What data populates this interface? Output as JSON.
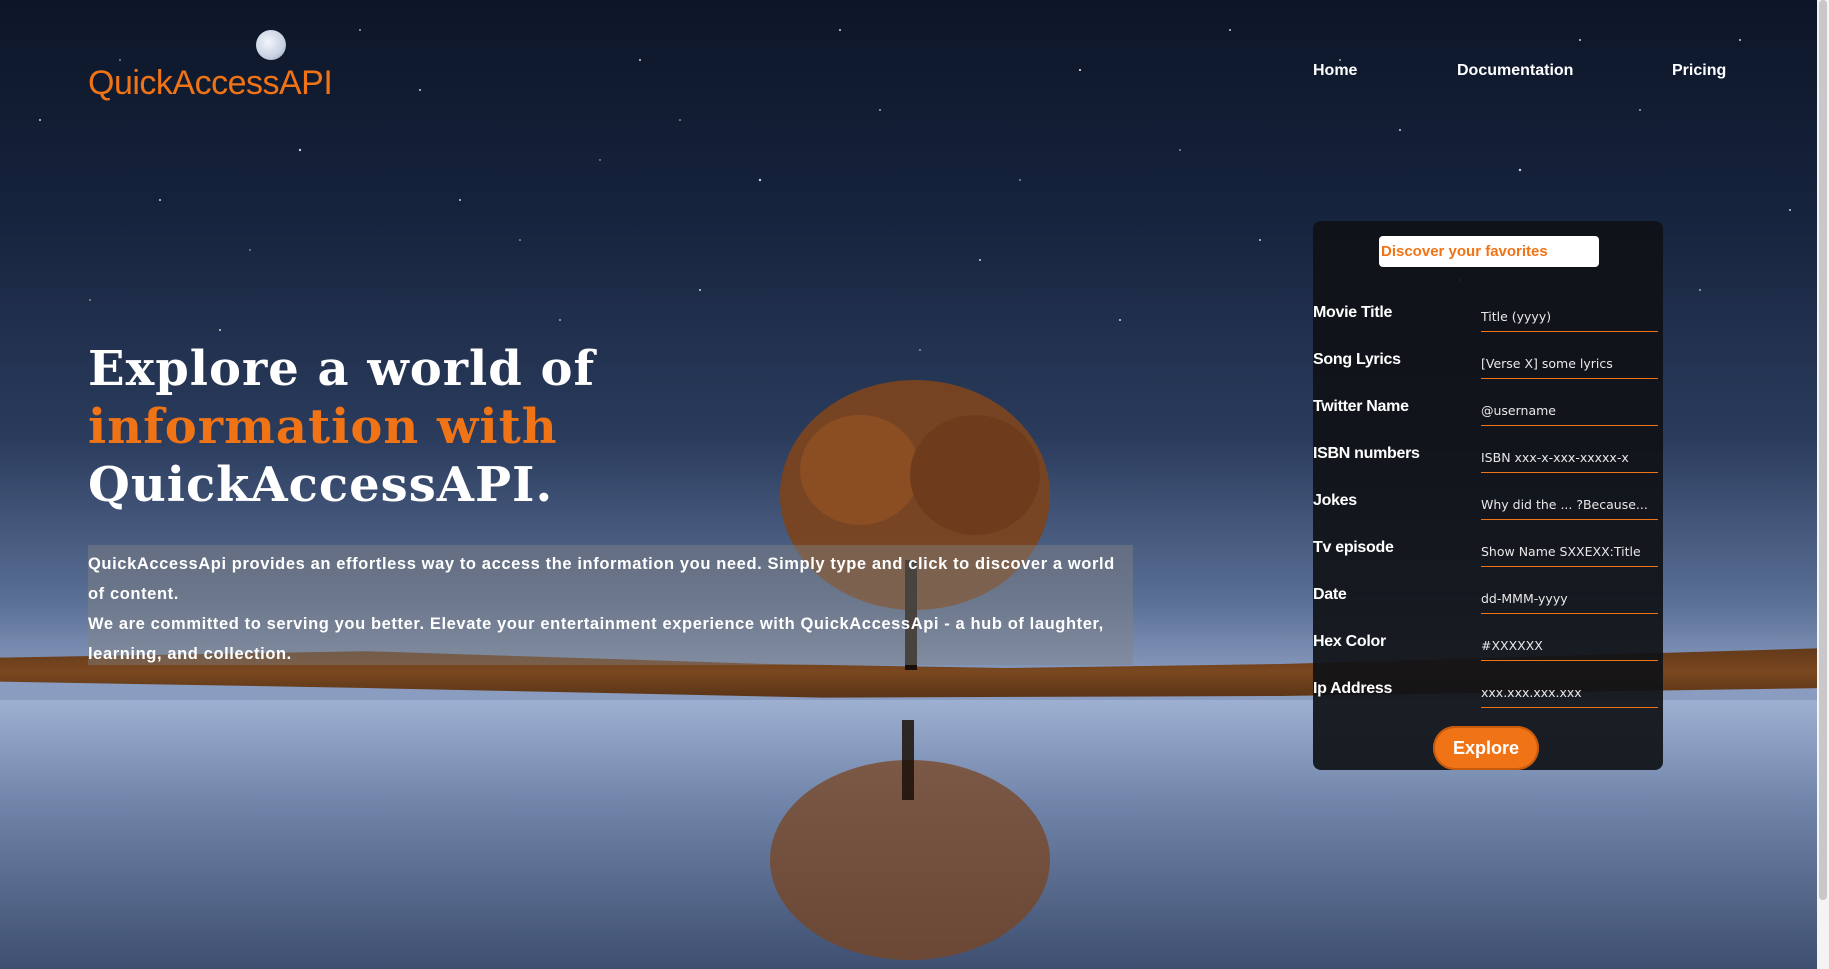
{
  "brand": {
    "name": "QuickAccessAPI"
  },
  "nav": {
    "home": "Home",
    "documentation": "Documentation",
    "pricing": "Pricing"
  },
  "hero": {
    "line1": "Explore a world of",
    "line2": "information with",
    "line3": "QuickAccessAPI.",
    "paragraph1": "QuickAccessApi provides an effortless way to access the information you need. Simply type and click to discover a world of content.",
    "paragraph2": "We are committed to serving you better. Elevate your entertainment experience with QuickAccessApi - a hub of laughter, learning, and collection."
  },
  "form": {
    "title": "Discover your favorites",
    "fields": [
      {
        "label": "Movie Title",
        "placeholder": "Title (yyyy)"
      },
      {
        "label": "Song Lyrics",
        "placeholder": "[Verse X] some lyrics"
      },
      {
        "label": "Twitter Name",
        "placeholder": "@username"
      },
      {
        "label": "ISBN numbers",
        "placeholder": "ISBN xxx-x-xxx-xxxxx-x"
      },
      {
        "label": "Jokes",
        "placeholder": "Why did the ... ?Because..."
      },
      {
        "label": "Tv episode",
        "placeholder": "Show Name SXXEXX:Title"
      },
      {
        "label": "Date",
        "placeholder": "dd-MMM-yyyy"
      },
      {
        "label": "Hex Color",
        "placeholder": "#XXXXXX"
      },
      {
        "label": "Ip Address",
        "placeholder": "xxx.xxx.xxx.xxx"
      }
    ],
    "button": "Explore"
  },
  "colors": {
    "accent": "#f07316",
    "card": "#0f1116",
    "text": "#ffffff"
  }
}
